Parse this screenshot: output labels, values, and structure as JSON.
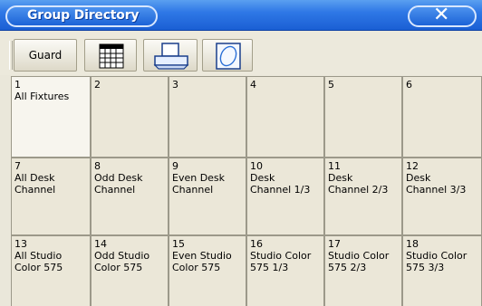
{
  "window": {
    "title": "Group Directory",
    "close_glyph": "✕",
    "colors": {
      "titlebar": "#2f78e6",
      "cell_bg": "#ebe7d8",
      "selected_bg": "#f7f5ee"
    }
  },
  "toolbar": {
    "guard_label": "Guard",
    "icons": [
      "spreadsheet-icon",
      "printer-icon",
      "disk-icon"
    ]
  },
  "groups": [
    {
      "num": "1",
      "label": "All Fixtures",
      "selected": true
    },
    {
      "num": "2",
      "label": ""
    },
    {
      "num": "3",
      "label": ""
    },
    {
      "num": "4",
      "label": ""
    },
    {
      "num": "5",
      "label": ""
    },
    {
      "num": "6",
      "label": ""
    },
    {
      "num": "7",
      "label": "All Desk\nChannel"
    },
    {
      "num": "8",
      "label": "Odd Desk\nChannel"
    },
    {
      "num": "9",
      "label": "Even Desk\nChannel"
    },
    {
      "num": "10",
      "label": "Desk\nChannel 1/3"
    },
    {
      "num": "11",
      "label": "Desk\nChannel 2/3"
    },
    {
      "num": "12",
      "label": "Desk\nChannel 3/3"
    },
    {
      "num": "13",
      "label": "All Studio\nColor 575"
    },
    {
      "num": "14",
      "label": "Odd Studio\nColor 575"
    },
    {
      "num": "15",
      "label": "Even Studio\nColor 575"
    },
    {
      "num": "16",
      "label": "Studio Color\n575 1/3"
    },
    {
      "num": "17",
      "label": "Studio Color\n575 2/3"
    },
    {
      "num": "18",
      "label": "Studio Color\n575 3/3"
    }
  ]
}
